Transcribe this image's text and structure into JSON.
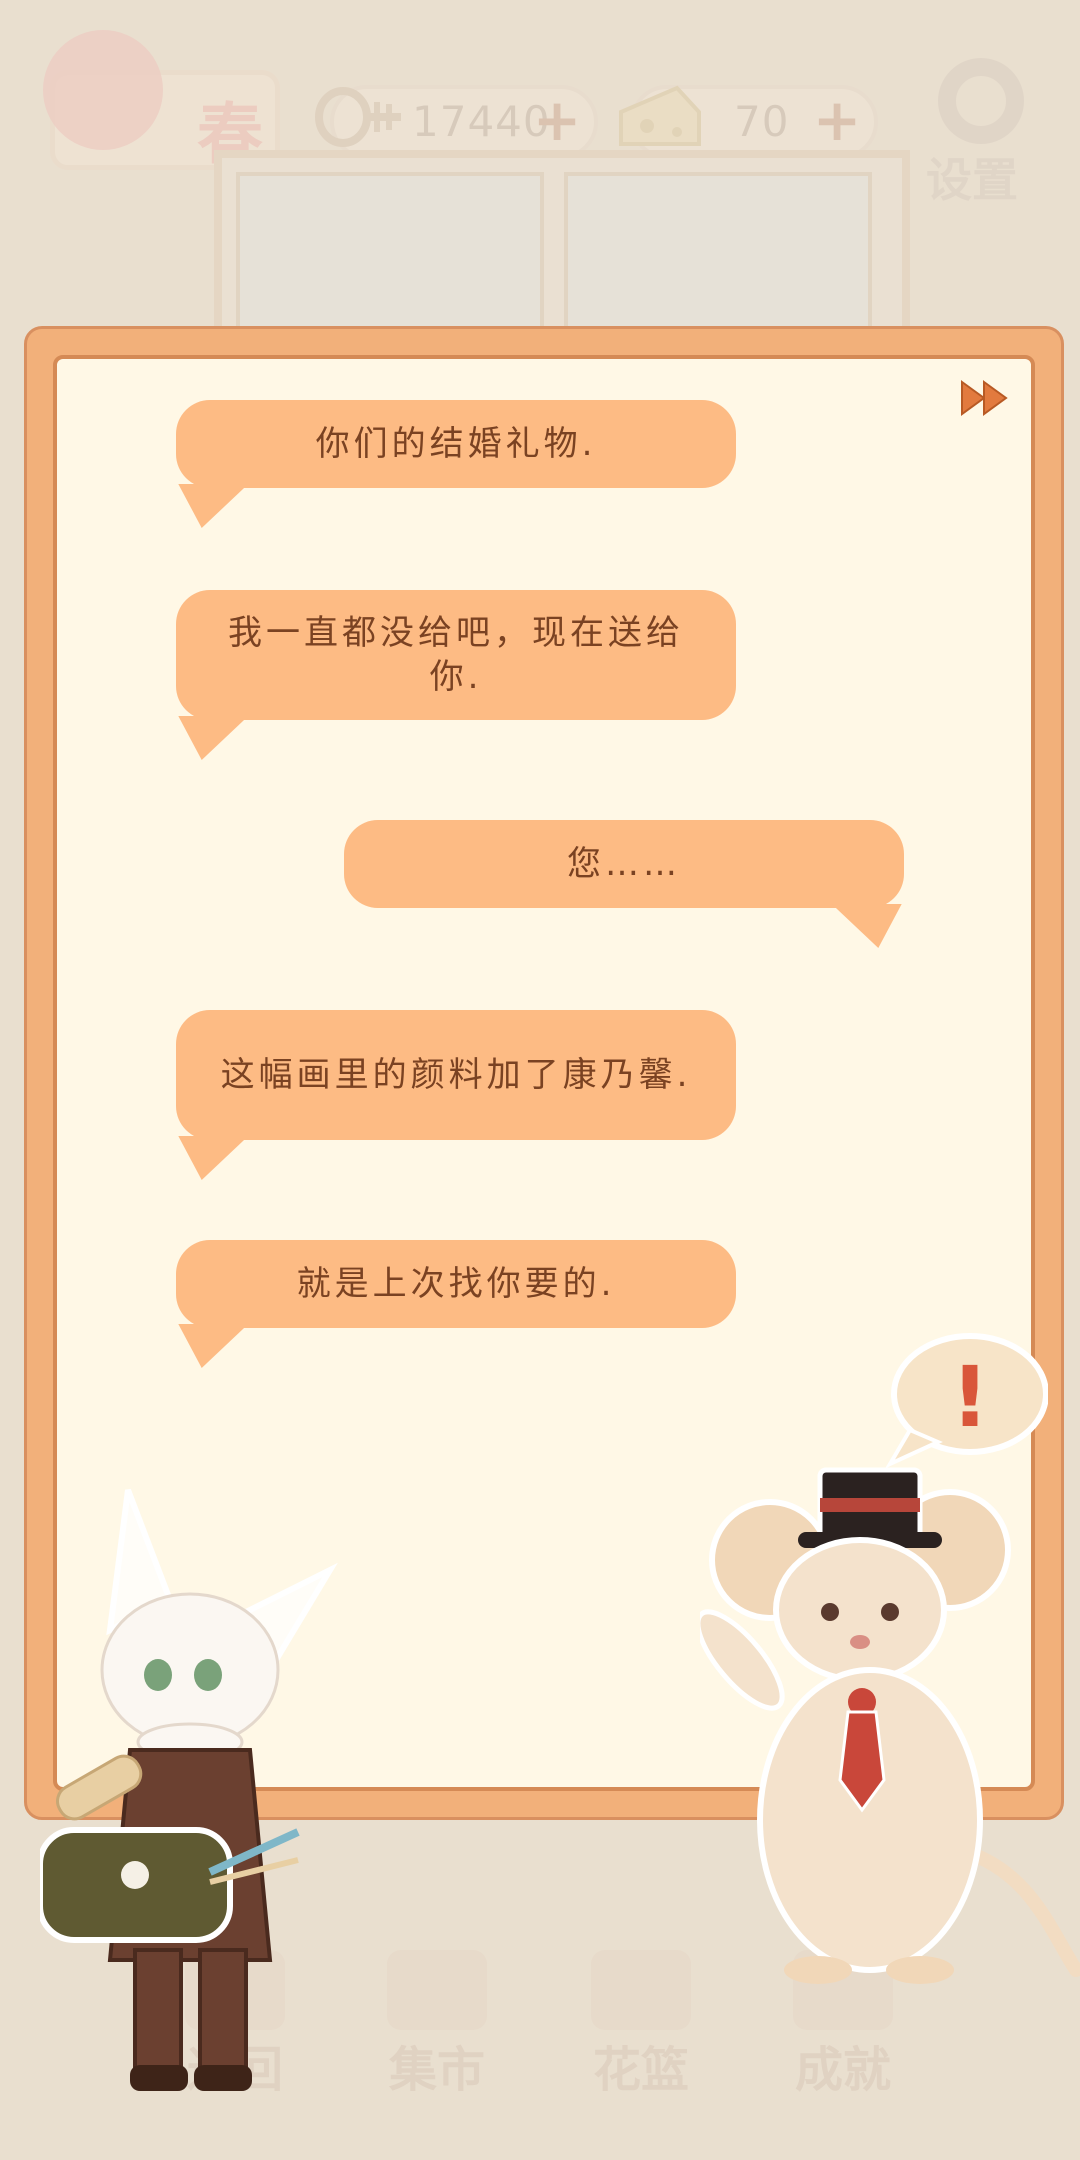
{
  "topbar": {
    "season_label": "春",
    "fish_count": "17440",
    "cheese_count": "70",
    "settings_label": "设置"
  },
  "navbar": {
    "back_label": "返回",
    "market_label": "集市",
    "basket_label": "花篮",
    "achieve_label": "成就"
  },
  "dialog": {
    "messages": [
      {
        "side": "left",
        "text": "你们的结婚礼物."
      },
      {
        "side": "left",
        "text": "我一直都没给吧，现在送给你."
      },
      {
        "side": "right",
        "text": "您……"
      },
      {
        "side": "left",
        "text": "这幅画里的颜料加了康乃馨."
      },
      {
        "side": "left",
        "text": "就是上次找你要的."
      }
    ]
  },
  "exclaim_mark": "!",
  "colors": {
    "bubble": "#fdbb84",
    "bubble_text": "#7a4222",
    "panel_border": "#f2b07a",
    "panel_bg": "#fff8e6"
  }
}
